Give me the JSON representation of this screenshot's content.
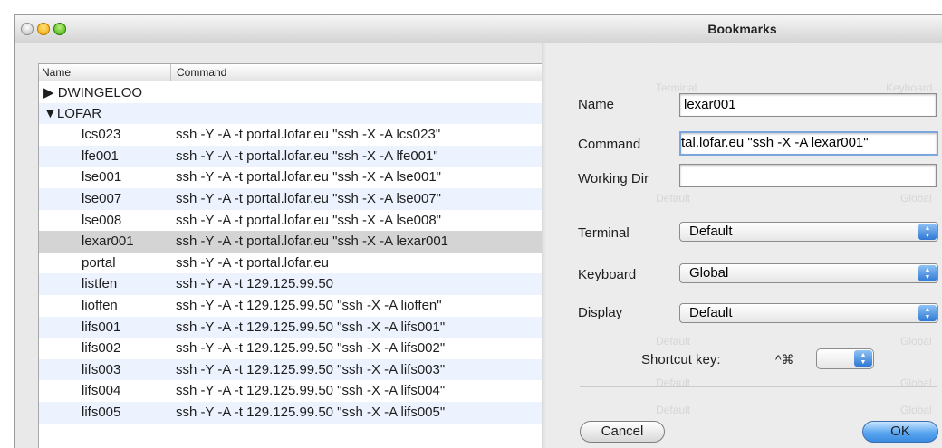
{
  "dialog": {
    "title": "Bookmarks",
    "name_label": "Name",
    "name_value": "lexar001",
    "command_label": "Command",
    "command_value": "tal.lofar.eu \"ssh -X -A lexar001\"",
    "workdir_label": "Working Dir",
    "workdir_value": "",
    "terminal_label": "Terminal",
    "terminal_value": "Default",
    "keyboard_label": "Keyboard",
    "keyboard_value": "Global",
    "display_label": "Display",
    "display_value": "Default",
    "shortcut_label": "Shortcut key:",
    "shortcut_modifiers": "^⌘",
    "cancel_label": "Cancel",
    "ok_label": "OK"
  },
  "table": {
    "col_name": "Name",
    "col_command": "Command",
    "rows": [
      {
        "name": "▶ DWINGELOO",
        "command": ""
      },
      {
        "name": "▼LOFAR",
        "command": ""
      },
      {
        "name": "lcs023",
        "command": "ssh -Y -A -t portal.lofar.eu \"ssh -X -A lcs023\""
      },
      {
        "name": "lfe001",
        "command": "ssh -Y -A -t portal.lofar.eu \"ssh -X -A lfe001\""
      },
      {
        "name": "lse001",
        "command": "ssh -Y -A -t portal.lofar.eu \"ssh -X -A lse001\""
      },
      {
        "name": "lse007",
        "command": "ssh -Y -A -t portal.lofar.eu \"ssh -X -A lse007\""
      },
      {
        "name": "lse008",
        "command": "ssh -Y -A -t portal.lofar.eu \"ssh -X -A lse008\""
      },
      {
        "name": "lexar001",
        "command": "ssh -Y -A -t portal.lofar.eu \"ssh -X -A lexar001"
      },
      {
        "name": "portal",
        "command": "ssh -Y -A -t portal.lofar.eu"
      },
      {
        "name": "listfen",
        "command": "ssh -Y -A -t 129.125.99.50"
      },
      {
        "name": "lioffen",
        "command": "ssh -Y -A -t 129.125.99.50 \"ssh -X -A lioffen\""
      },
      {
        "name": "lifs001",
        "command": "ssh -Y -A -t 129.125.99.50 \"ssh -X -A lifs001\""
      },
      {
        "name": "lifs002",
        "command": "ssh -Y -A -t 129.125.99.50 \"ssh -X -A lifs002\""
      },
      {
        "name": "lifs003",
        "command": "ssh -Y -A -t 129.125.99.50 \"ssh -X -A lifs003\""
      },
      {
        "name": "lifs004",
        "command": "ssh -Y -A -t 129.125.99.50 \"ssh -X -A lifs004\""
      },
      {
        "name": "lifs005",
        "command": "ssh -Y -A -t 129.125.99.50 \"ssh -X -A lifs005\""
      }
    ]
  },
  "ghost_text": {
    "terminal": "Terminal",
    "keyboard": "Keyboard",
    "default": "Default",
    "global": "Global"
  }
}
